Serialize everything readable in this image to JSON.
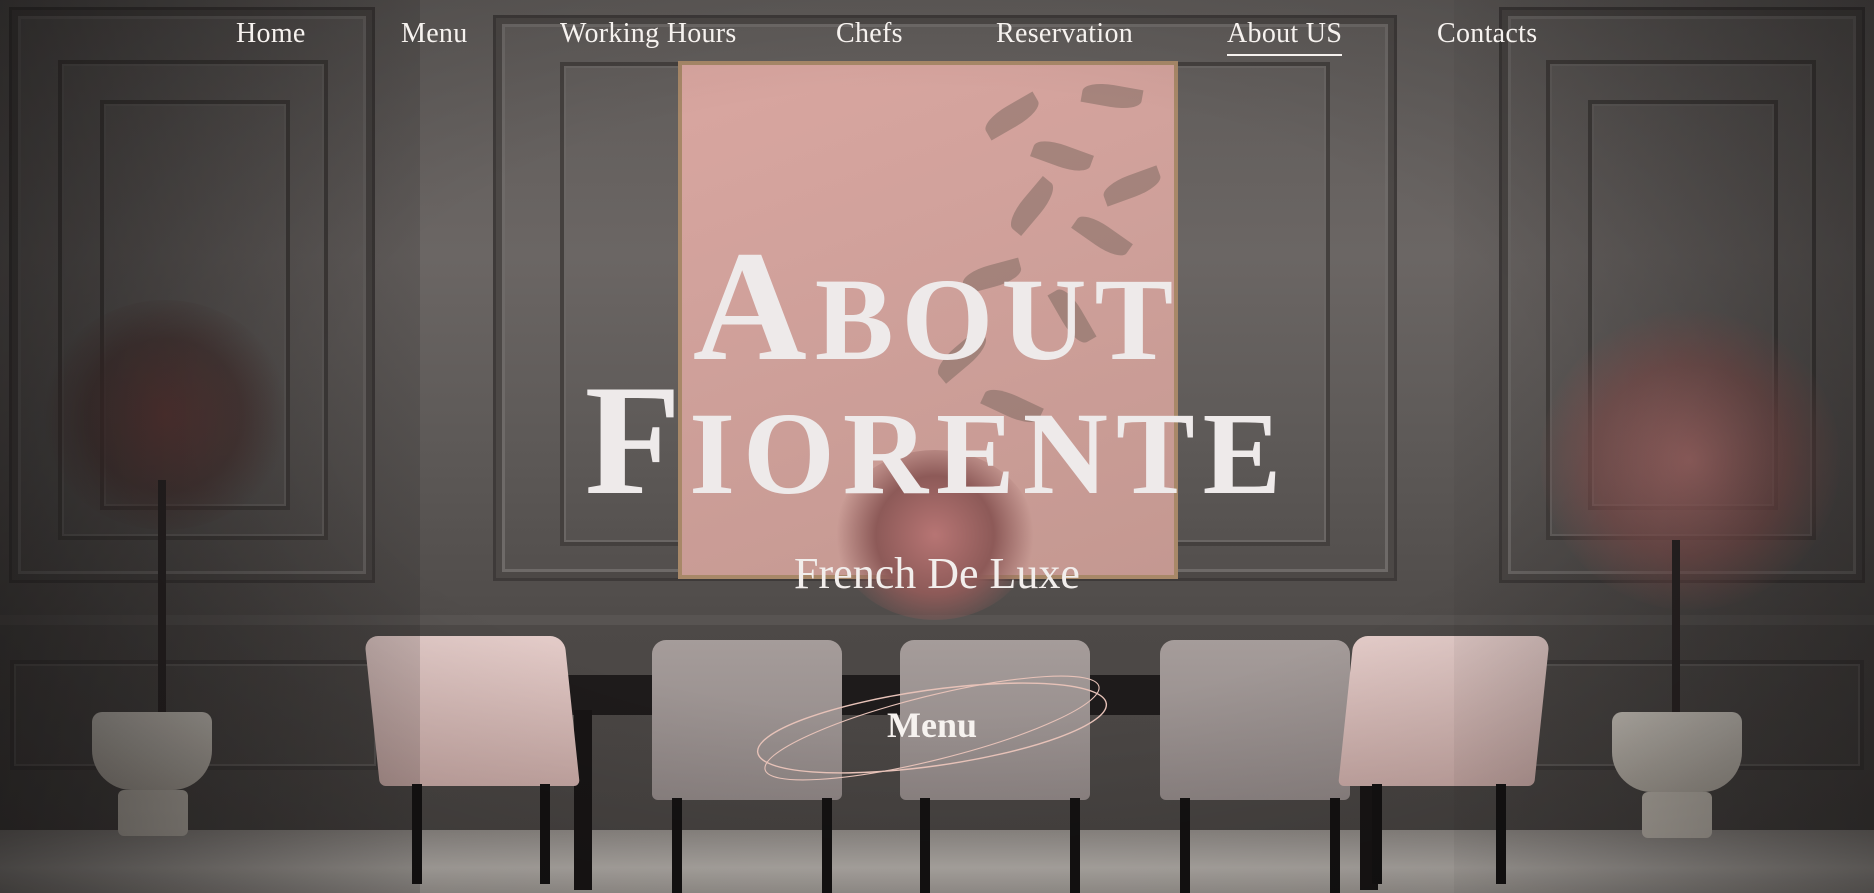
{
  "nav": {
    "items": [
      {
        "label": "Home"
      },
      {
        "label": "Menu"
      },
      {
        "label": "Working Hours"
      },
      {
        "label": "Chefs"
      },
      {
        "label": "Reservation"
      },
      {
        "label": "About US",
        "active": true
      },
      {
        "label": "Contacts"
      }
    ]
  },
  "hero": {
    "line1": "About",
    "line2": "Fiorente",
    "subtitle": "French De Luxe"
  },
  "cta": {
    "menu_label": "Menu"
  },
  "colors": {
    "text": "#f3efec",
    "wall": "#5e5a58",
    "artwork": "#d9a6a0",
    "accent_ring": "#e7c2b8"
  }
}
